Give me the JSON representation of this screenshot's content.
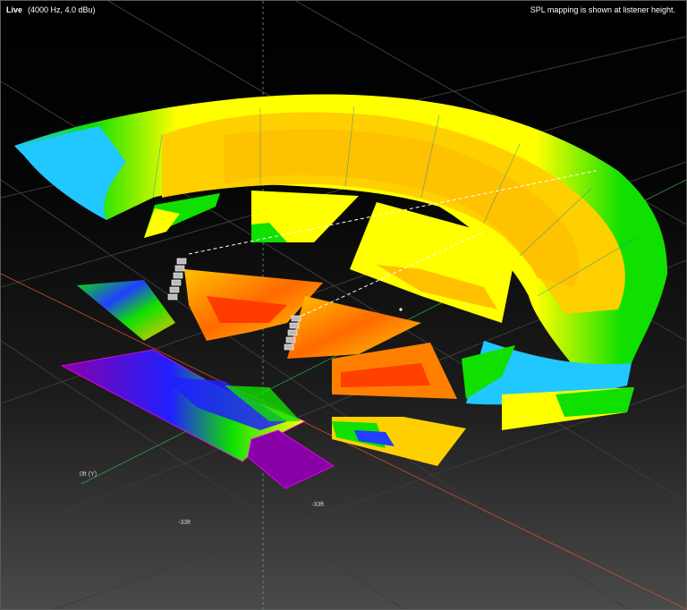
{
  "header": {
    "mode": "Live",
    "settings": "(4000 Hz, 4.0 dBu)",
    "note": "SPL mapping is shown at listener height."
  },
  "axes": {
    "y_origin_label": "0ft (Y)",
    "label_a": "-33ft",
    "label_b": "-33ft"
  },
  "colors": {
    "background_top": "#000000",
    "background_bottom": "#4a4a4a",
    "spl_yellow": "#ffff00",
    "spl_orange": "#ffc000",
    "spl_red": "#ff3000",
    "spl_green": "#10e000",
    "spl_cyan": "#20c8ff",
    "spl_blue": "#2020ff",
    "spl_purple": "#8800a8",
    "outline_magenta": "#ff00ff"
  },
  "icons": [
    "line-array-speaker-left",
    "line-array-speaker-right"
  ]
}
